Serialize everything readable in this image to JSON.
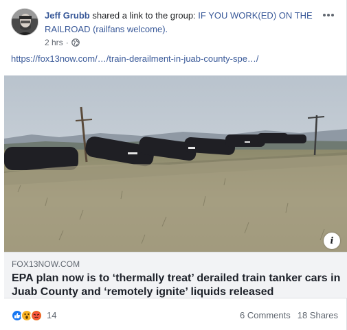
{
  "post": {
    "author": "Jeff Grubb",
    "action_text": " shared a link to the group: ",
    "group": "IF YOU WORK(ED) ON THE RAILROAD (railfans welcome).",
    "time": "2 hrs",
    "time_separator": "·",
    "audience_icon": "globe-icon",
    "more_icon": "more-options-icon"
  },
  "link": {
    "url_text": "https://fox13now.com/…/train-derailment-in-juab-county-spe…/",
    "domain": "FOX13NOW.COM",
    "title": "EPA plan now is to ‘thermally treat’ derailed train tanker cars in Juab County and ‘remotely ignite’ liquids released",
    "info_icon": "info-icon",
    "info_glyph": "i"
  },
  "footer": {
    "reactions": [
      "like",
      "wow",
      "angry"
    ],
    "reaction_count": "14",
    "comments": "6 Comments",
    "shares": "18 Shares"
  },
  "colors": {
    "link_blue": "#385898",
    "like_blue": "#1877f2",
    "wow_yellow": "#f7b125",
    "angry_orange": "#e9710f"
  }
}
